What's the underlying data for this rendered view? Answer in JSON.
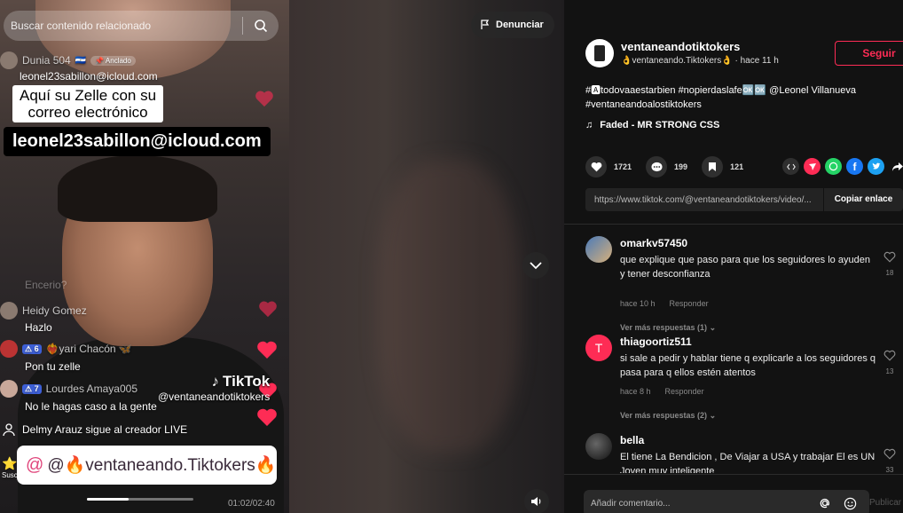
{
  "video": {
    "search_placeholder": "Buscar contenido relacionado",
    "pinned_comment": {
      "user": "Dunia 504",
      "flag": "🇸🇻",
      "pinned_label": "Anclado",
      "text": "leonel23sabillon@icloud.com"
    },
    "caption_white": "Aquí su Zelle con su\ncorreo electrónico",
    "caption_black": "leonel23sabillon@icloud.com",
    "faded_text": "Encerio?",
    "live_comments": [
      {
        "user": "Heidy Gomez",
        "badge": "",
        "text": "Hazlo"
      },
      {
        "user": "❤️‍🔥yari Chacón 🦋",
        "badge": "6",
        "text": "Pon tu zelle"
      },
      {
        "user": "Lourdes Amaya005",
        "badge": "7",
        "text": "No le hagas caso a la gente"
      }
    ],
    "follow_event": "Delmy Arauz sigue al creador LIVE",
    "subscribe_stub": "Susc",
    "watermark_logo": "TikTok",
    "watermark_handle": "@ventaneandotiktokers",
    "banner": "@🔥ventaneando.Tiktokers🔥",
    "time": "01:02/02:40",
    "progress": 0.39
  },
  "middle": {
    "report_label": "Denunciar"
  },
  "panel": {
    "author_name": "ventaneandotiktokers",
    "author_sub": "👌ventaneando.Tiktokers👌 · hace 11 h",
    "follow_label": "Seguir",
    "description": "#🅰todovaaestarbien #nopierdaslafe🆗🆗 @Leonel Villanueva #ventaneandoalostiktokers",
    "music": "Faded - MR STRONG CSS",
    "likes": "1721",
    "comments": "199",
    "saves": "121",
    "url": "https://www.tiktok.com/@ventaneandotiktokers/video/...",
    "copy_label": "Copiar enlace",
    "comment_placeholder": "Añadir comentario...",
    "publish_label": "Publicar",
    "comment_list": [
      {
        "user": "omarkv57450",
        "text": "que explique que paso para que los seguidores lo ayuden y tener desconfianza",
        "time": "hace 10 h",
        "reply": "Responder",
        "likes": "18",
        "more": "Ver más respuestas (1)"
      },
      {
        "user": "thiagoortiz511",
        "text": "si sale a pedir y hablar tiene q explicarle a los seguidores q pasa para q ellos estén atentos",
        "time": "hace 8 h",
        "reply": "Responder",
        "likes": "13",
        "more": "Ver más respuestas (2)"
      },
      {
        "user": "bella",
        "text": "El tiene La Bendicion , De Viajar a USA y trabajar El es UN Joven muy inteligente",
        "time": "",
        "reply": "",
        "likes": "33",
        "more": ""
      }
    ],
    "colors": {
      "accent": "#fe2c55",
      "comment_avatar_2": "#fe2c55"
    }
  }
}
